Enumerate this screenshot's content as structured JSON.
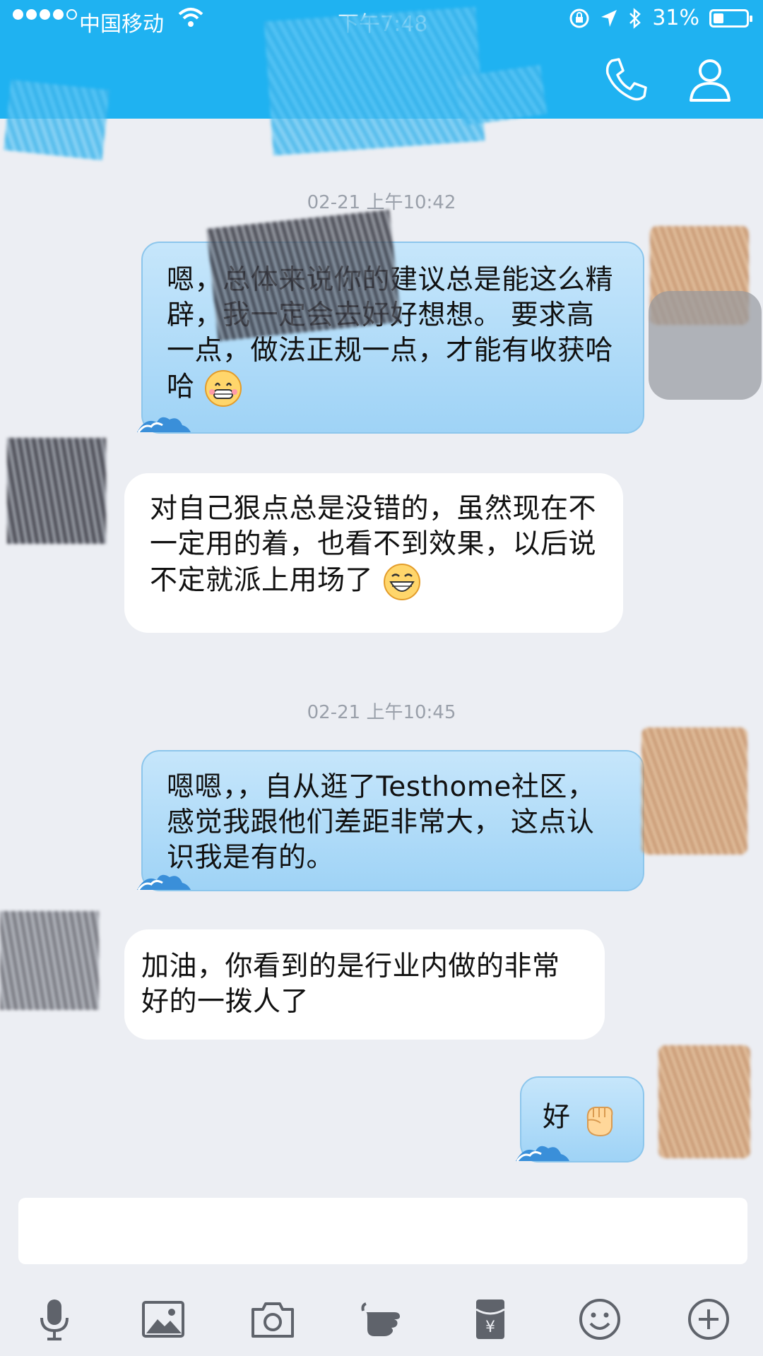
{
  "status_bar": {
    "carrier": "中国移动",
    "time": "下午7:48",
    "battery_percent": "31%",
    "battery_level": 0.31,
    "signal_bars_filled": 4,
    "signal_bars_total": 5
  },
  "header": {
    "title": "",
    "call_icon": "phone-icon",
    "profile_icon": "person-icon",
    "accent_color": "#1fb2f1"
  },
  "messages": [
    {
      "type": "timestamp",
      "text": "02-21 上午10:42"
    },
    {
      "type": "outgoing",
      "text": "嗯，总体来说你的建议总是能这么精辟，我一定会去好好想想。 要求高一点，做法正规一点，才能有收获哈哈",
      "emoji": "grin-emoji"
    },
    {
      "type": "incoming",
      "text": "对自己狠点总是没错的，虽然现在不一定用的着，也看不到效果，以后说不定就派上用场了",
      "emoji": "laugh-emoji"
    },
    {
      "type": "timestamp",
      "text": "02-21 上午10:45"
    },
    {
      "type": "outgoing",
      "text": "嗯嗯，，自从逛了Testhome社区，感觉我跟他们差距非常大，  这点认识我是有的。"
    },
    {
      "type": "incoming",
      "text": "加油，你看到的是行业内做的非常好的一拨人了"
    },
    {
      "type": "outgoing",
      "text": "好",
      "emoji": "fist-emoji"
    }
  ],
  "input": {
    "value": "",
    "placeholder": ""
  },
  "toolbar": [
    "microphone-icon",
    "image-icon",
    "camera-icon",
    "poke-hand-icon",
    "red-packet-icon",
    "emoji-icon",
    "plus-icon"
  ]
}
